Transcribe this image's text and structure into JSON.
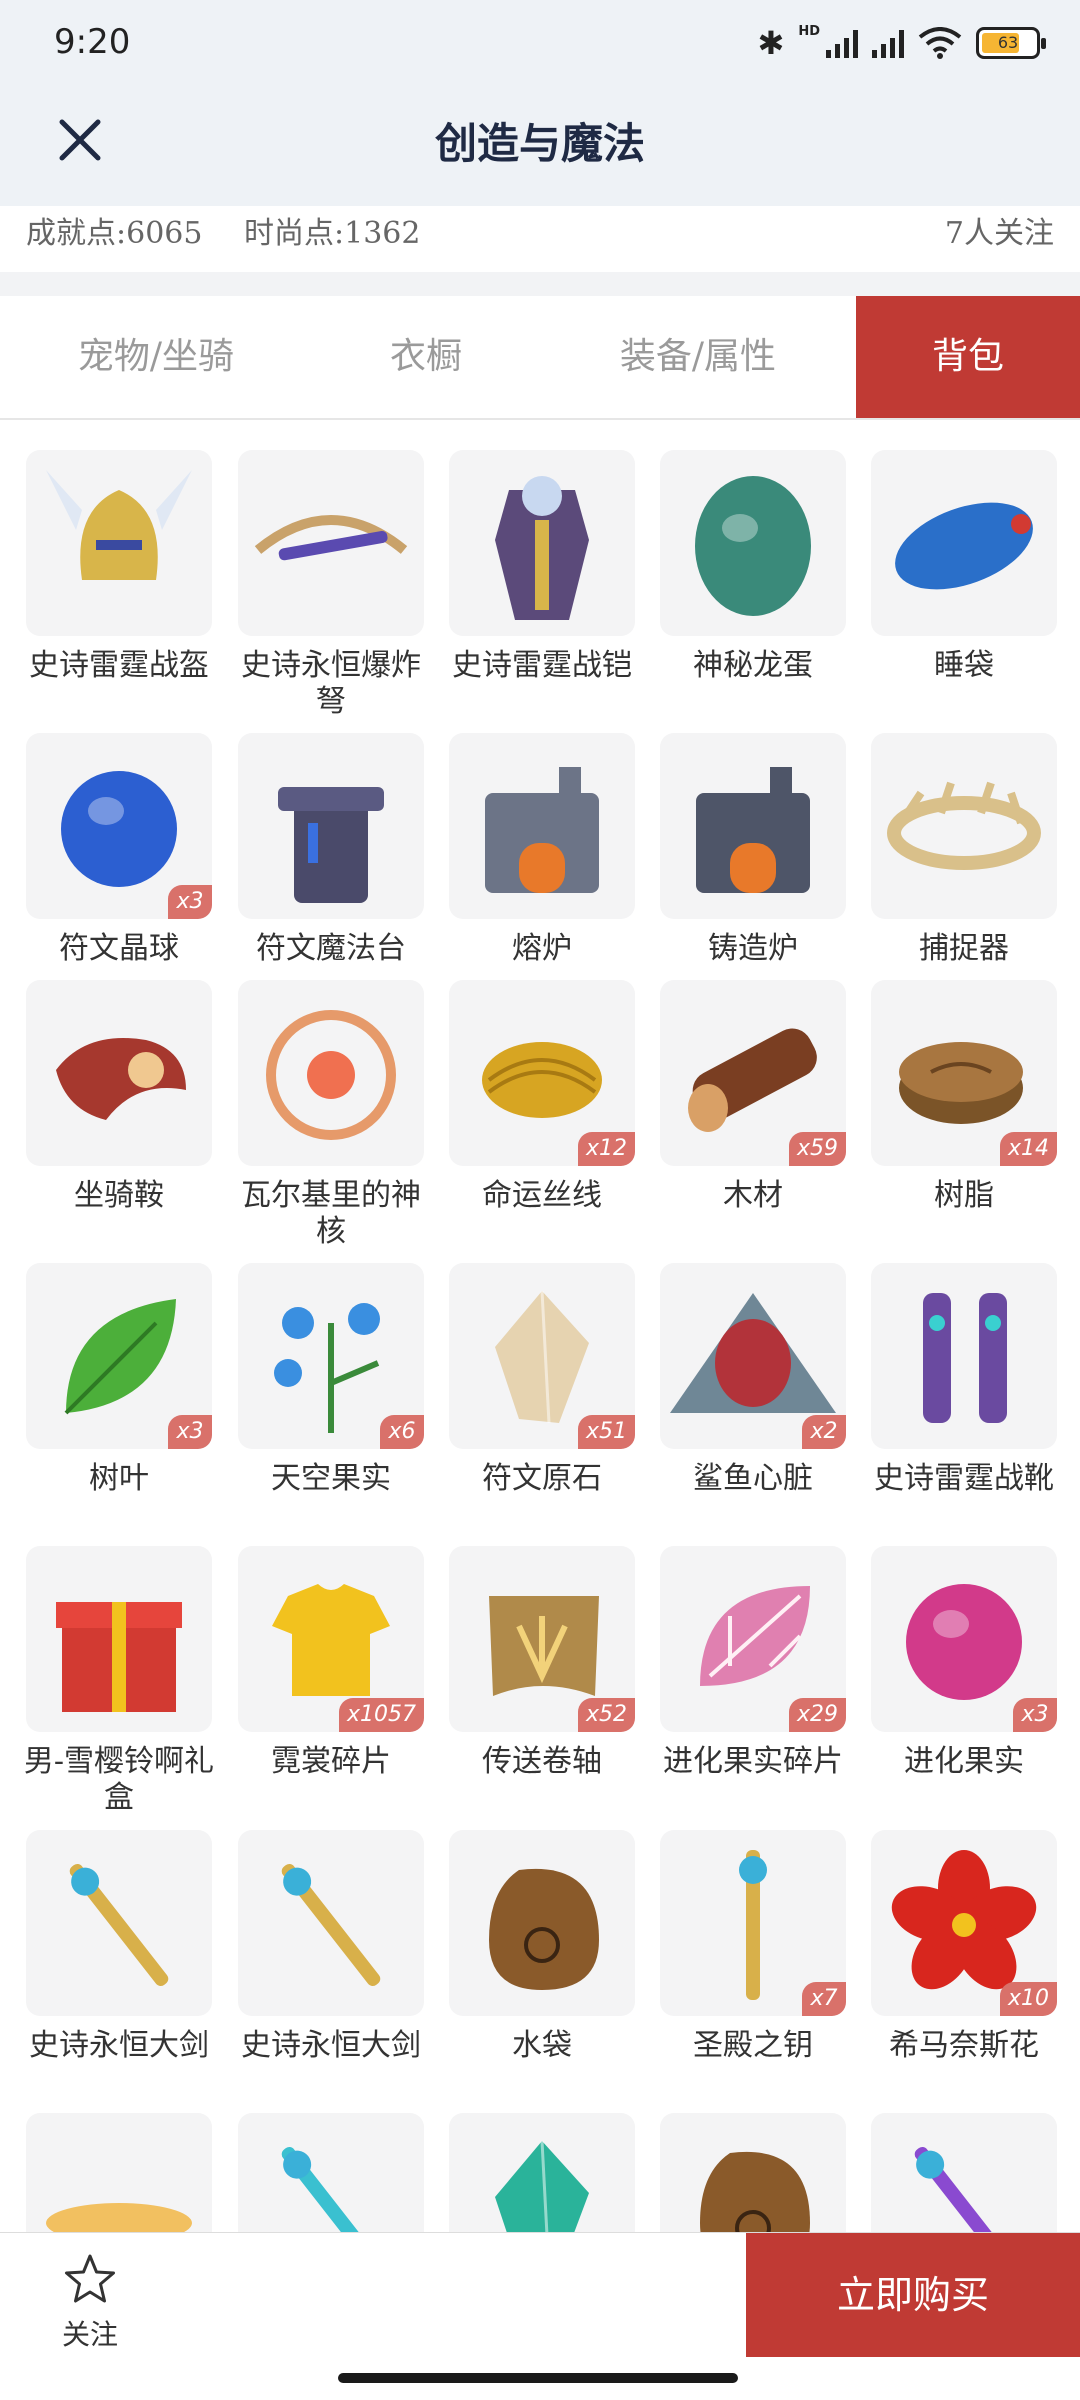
{
  "status": {
    "time": "9:20",
    "hd": "HD",
    "battery": "63",
    "icons": [
      "bluetooth-icon",
      "signal-icon",
      "wifi-icon",
      "battery-icon"
    ]
  },
  "header": {
    "title": "创造与魔法",
    "close_icon": "close-icon"
  },
  "stats": {
    "achievement": "成就点:6065",
    "fashion": "时尚点:1362",
    "followers": "7人关注"
  },
  "tabs": [
    {
      "label": "宠物/坐骑",
      "active": false
    },
    {
      "label": "衣橱",
      "active": false
    },
    {
      "label": "装备/属性",
      "active": false
    },
    {
      "label": "背包",
      "active": true
    }
  ],
  "items": [
    {
      "name": "史诗雷霆战盔",
      "badge": "",
      "icon": "epic-helmet-icon",
      "color": "#d8b54a"
    },
    {
      "name": "史诗永恒爆炸弩",
      "badge": "",
      "icon": "crossbow-icon",
      "color": "#c9a26a"
    },
    {
      "name": "史诗雷霆战铠",
      "badge": "",
      "icon": "armor-icon",
      "color": "#5b4a7a"
    },
    {
      "name": "神秘龙蛋",
      "badge": "",
      "icon": "dragon-egg-icon",
      "color": "#3a8a7a"
    },
    {
      "name": "睡袋",
      "badge": "",
      "icon": "sleeping-bag-icon",
      "color": "#2a6fc9"
    },
    {
      "name": "符文晶球",
      "badge": "x3",
      "icon": "rune-orb-icon",
      "color": "#2c5fd1"
    },
    {
      "name": "符文魔法台",
      "badge": "",
      "icon": "rune-altar-icon",
      "color": "#4a4a6a"
    },
    {
      "name": "熔炉",
      "badge": "",
      "icon": "furnace-icon",
      "color": "#6c7487"
    },
    {
      "name": "铸造炉",
      "badge": "",
      "icon": "foundry-icon",
      "color": "#4e5568"
    },
    {
      "name": "捕捉器",
      "badge": "",
      "icon": "trap-icon",
      "color": "#d9c08a"
    },
    {
      "name": "坐骑鞍",
      "badge": "",
      "icon": "saddle-icon",
      "color": "#a6382e"
    },
    {
      "name": "瓦尔基里的神核",
      "badge": "",
      "icon": "valkyrie-core-icon",
      "color": "#e69a6a"
    },
    {
      "name": "命运丝线",
      "badge": "x12",
      "icon": "thread-icon",
      "color": "#d7a522"
    },
    {
      "name": "木材",
      "badge": "x59",
      "icon": "wood-icon",
      "color": "#7a3e22"
    },
    {
      "name": "树脂",
      "badge": "x14",
      "icon": "resin-icon",
      "color": "#7b5428"
    },
    {
      "name": "树叶",
      "badge": "x3",
      "icon": "leaf-icon",
      "color": "#4caf3a"
    },
    {
      "name": "天空果实",
      "badge": "x6",
      "icon": "sky-fruit-icon",
      "color": "#3a8fe0"
    },
    {
      "name": "符文原石",
      "badge": "x51",
      "icon": "rune-stone-icon",
      "color": "#e6d3b0"
    },
    {
      "name": "鲨鱼心脏",
      "badge": "x2",
      "icon": "shark-heart-icon",
      "color": "#b2333a"
    },
    {
      "name": "史诗雷霆战靴",
      "badge": "",
      "icon": "boots-icon",
      "color": "#6a4aa0"
    },
    {
      "name": "男-雪樱铃啊礼盒",
      "badge": "",
      "icon": "gift-box-icon",
      "color": "#d23a32"
    },
    {
      "name": "霓裳碎片",
      "badge": "x1057",
      "icon": "shirt-icon",
      "color": "#f2c21e"
    },
    {
      "name": "传送卷轴",
      "badge": "x52",
      "icon": "scroll-icon",
      "color": "#b08a4a"
    },
    {
      "name": "进化果实碎片",
      "badge": "x29",
      "icon": "fruit-shard-icon",
      "color": "#e080b0"
    },
    {
      "name": "进化果实",
      "badge": "x3",
      "icon": "evolution-fruit-icon",
      "color": "#d23a8a"
    },
    {
      "name": "史诗永恒大剑",
      "badge": "",
      "icon": "greatsword-icon",
      "color": "#d8b04a"
    },
    {
      "name": "史诗永恒大剑",
      "badge": "",
      "icon": "greatsword-icon",
      "color": "#d8b04a"
    },
    {
      "name": "水袋",
      "badge": "",
      "icon": "water-bag-icon",
      "color": "#8a5a2a"
    },
    {
      "name": "圣殿之钥",
      "badge": "x7",
      "icon": "key-icon",
      "color": "#d8b04a"
    },
    {
      "name": "希马奈斯花",
      "badge": "x10",
      "icon": "flower-icon",
      "color": "#d8261e"
    },
    {
      "name": "",
      "badge": "",
      "icon": "noodle-bowl-icon",
      "color": "#e07a2a"
    },
    {
      "name": "",
      "badge": "",
      "icon": "staff-icon",
      "color": "#3ac0d0"
    },
    {
      "name": "",
      "badge": "",
      "icon": "crystal-icon",
      "color": "#2ab39a"
    },
    {
      "name": "",
      "badge": "",
      "icon": "water-bag-icon",
      "color": "#8a5a2a"
    },
    {
      "name": "",
      "badge": "",
      "icon": "magic-staff-icon",
      "color": "#8a4ad0"
    }
  ],
  "bottom": {
    "follow_label": "关注",
    "follow_icon": "star-icon",
    "buy_label": "立即购买"
  }
}
